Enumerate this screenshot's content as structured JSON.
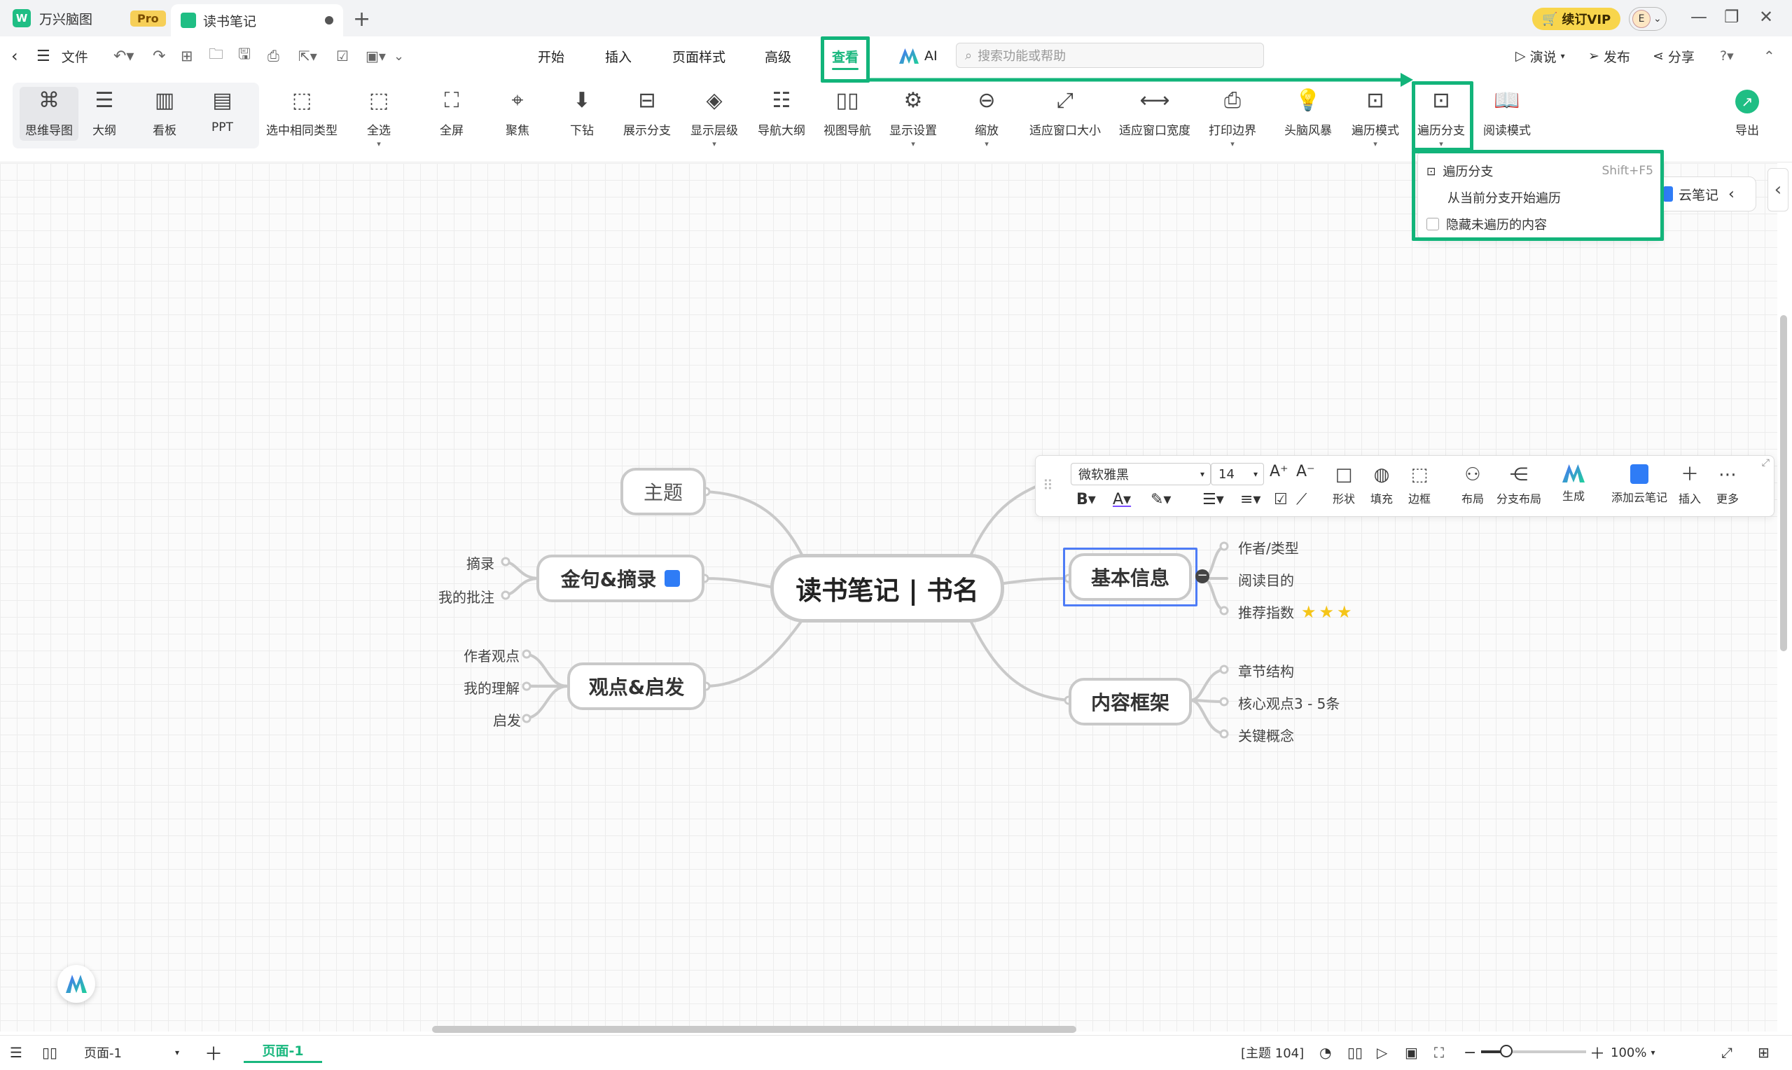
{
  "titlebar": {
    "app_name": "万兴脑图",
    "pro": "Pro",
    "doc_tab": "读书笔记",
    "vip": "续订VIP",
    "avatar_letter": "E"
  },
  "menubar": {
    "file": "文件",
    "tabs": [
      "开始",
      "插入",
      "页面样式",
      "高级",
      "查看",
      "AI"
    ],
    "search_placeholder": "搜索功能或帮助",
    "right": [
      "演说",
      "发布",
      "分享"
    ]
  },
  "ribbon": {
    "views": [
      "思维导图",
      "大纲",
      "看板",
      "PPT"
    ],
    "items": [
      "选中相同类型",
      "全选",
      "全屏",
      "聚焦",
      "下钻",
      "展示分支",
      "显示层级",
      "导航大纲",
      "视图导航",
      "显示设置",
      "缩放",
      "适应窗口大小",
      "适应窗口宽度",
      "打印边界",
      "头脑风暴",
      "遍历模式",
      "遍历分支",
      "阅读模式"
    ],
    "export": "导出"
  },
  "dropdown": {
    "items": [
      {
        "label": "遍历分支",
        "shortcut": "Shift+F5"
      },
      {
        "label": "从当前分支开始遍历",
        "shortcut": ""
      },
      {
        "label": "隐藏未遍历的内容",
        "shortcut": ""
      }
    ]
  },
  "cloud_note": "云笔记",
  "float_toolbar": {
    "font": "微软雅黑",
    "size": "14",
    "buttons": [
      "形状",
      "填充",
      "边框",
      "布局",
      "分支布局",
      "生成",
      "添加云笔记",
      "插入",
      "更多"
    ]
  },
  "mindmap": {
    "central": "读书笔记 | 书名",
    "left": [
      {
        "label": "主题",
        "children": []
      },
      {
        "label": "金句&摘录",
        "children": [
          "摘录",
          "我的批注"
        ]
      },
      {
        "label": "观点&启发",
        "children": [
          "作者观点",
          "我的理解",
          "启发"
        ]
      }
    ],
    "right": [
      {
        "label": "基本信息",
        "children": [
          "作者/类型",
          "阅读目的",
          "推荐指数"
        ]
      },
      {
        "label": "内容框架",
        "children": [
          "章节结构",
          "核心观点3 - 5条",
          "关键概念"
        ]
      }
    ]
  },
  "statusbar": {
    "page_select": "页面-1",
    "page_tab": "页面-1",
    "topic_count": "[主题 104]",
    "zoom": "100%"
  },
  "colors": {
    "accent": "#19b77e",
    "highlight": "#12b47a",
    "select": "#4e7cf6",
    "star": "#f5c518"
  }
}
